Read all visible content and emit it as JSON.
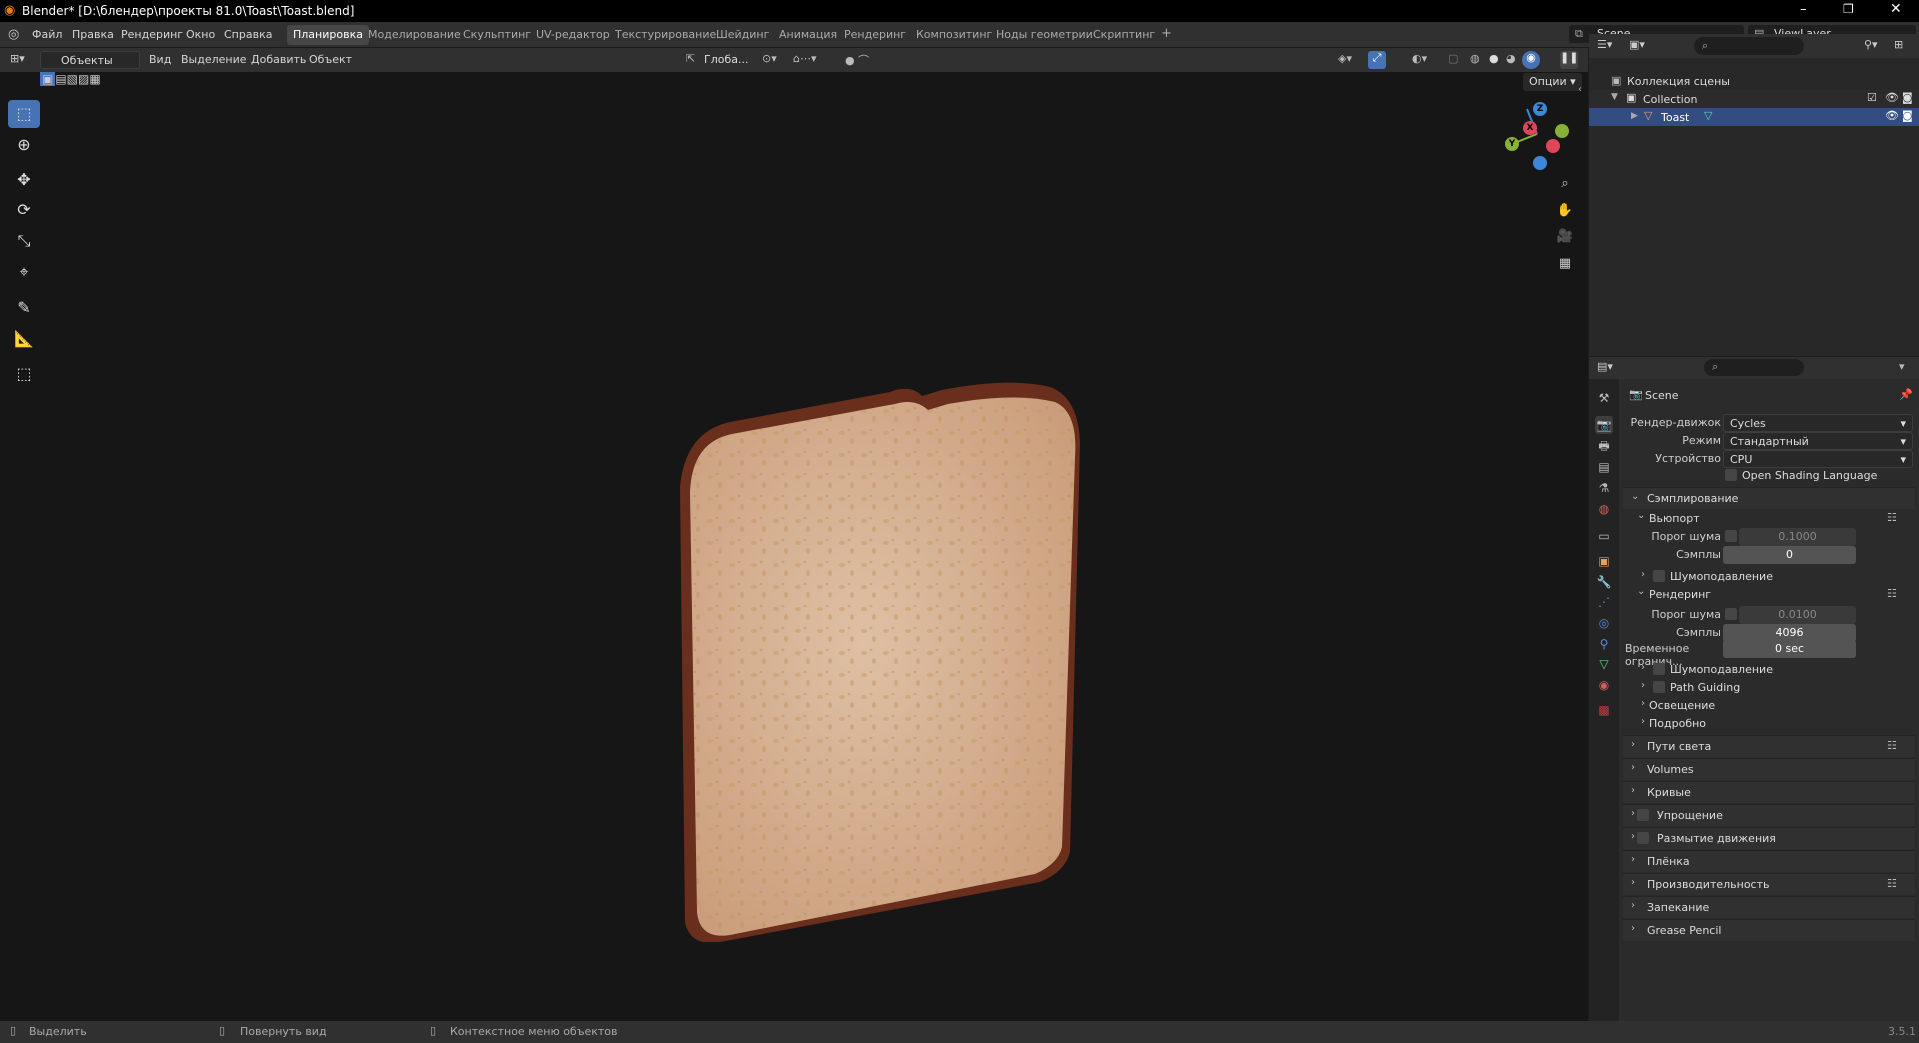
{
  "title": "Blender* [D:\\блендер\\проекты 81.0\\Toast\\Toast.blend]",
  "menu": [
    "Файл",
    "Правка",
    "Рендеринг",
    "Окно",
    "Справка"
  ],
  "workspaces": [
    "Планировка",
    "Моделирование",
    "Скульптинг",
    "UV-редактор",
    "Текстурирование",
    "Шейдинг",
    "Анимация",
    "Рендеринг",
    "Композитинг",
    "Ноды геометрии",
    "Скриптинг"
  ],
  "active_workspace": "Планировка",
  "scene": "Scene",
  "view_layer": "ViewLayer",
  "viewport_header": {
    "mode": "Объекты",
    "menus": [
      "Вид",
      "Выделение",
      "Добавить",
      "Объект"
    ],
    "orientation": "Глоба...",
    "options": "Опции"
  },
  "outliner": {
    "root": "Коллекция сцены",
    "collection": "Collection",
    "object": "Toast"
  },
  "properties": {
    "scene_label": "Scene",
    "render_engine_label": "Рендер-движок",
    "render_engine": "Cycles",
    "mode_label": "Режим",
    "mode": "Стандартный",
    "device_label": "Устройство",
    "device": "CPU",
    "osl": "Open Shading Language",
    "sampling": "Сэмплирование",
    "viewport": "Вьюпорт",
    "noise_threshold_label": "Порог шума",
    "viewport_noise": "0.1000",
    "samples_label": "Сэмплы",
    "viewport_samples": "0",
    "denoise": "Шумоподавление",
    "render": "Рендеринг",
    "render_noise": "0.0100",
    "render_samples": "4096",
    "time_limit_label": "Временное огранич...",
    "time_limit": "0 sec",
    "path_guiding": "Path Guiding",
    "lights": "Освещение",
    "advanced": "Подробно",
    "panels": [
      "Пути света",
      "Volumes",
      "Кривые",
      "Упрощение",
      "Размытие движения",
      "Плёнка",
      "Производительность",
      "Запекание",
      "Grease Pencil"
    ]
  },
  "status": {
    "select": "Выделить",
    "rotate": "Повернуть вид",
    "context": "Контекстное меню объектов",
    "version": "3.5.1"
  },
  "gizmo": {
    "x": "X",
    "y": "Y",
    "z": "Z"
  },
  "colors": {
    "accent": "#4772b3",
    "x_axis": "#e0465a",
    "y_axis": "#86b23a",
    "z_axis": "#3d87d8",
    "toast": "#d9b79a"
  }
}
